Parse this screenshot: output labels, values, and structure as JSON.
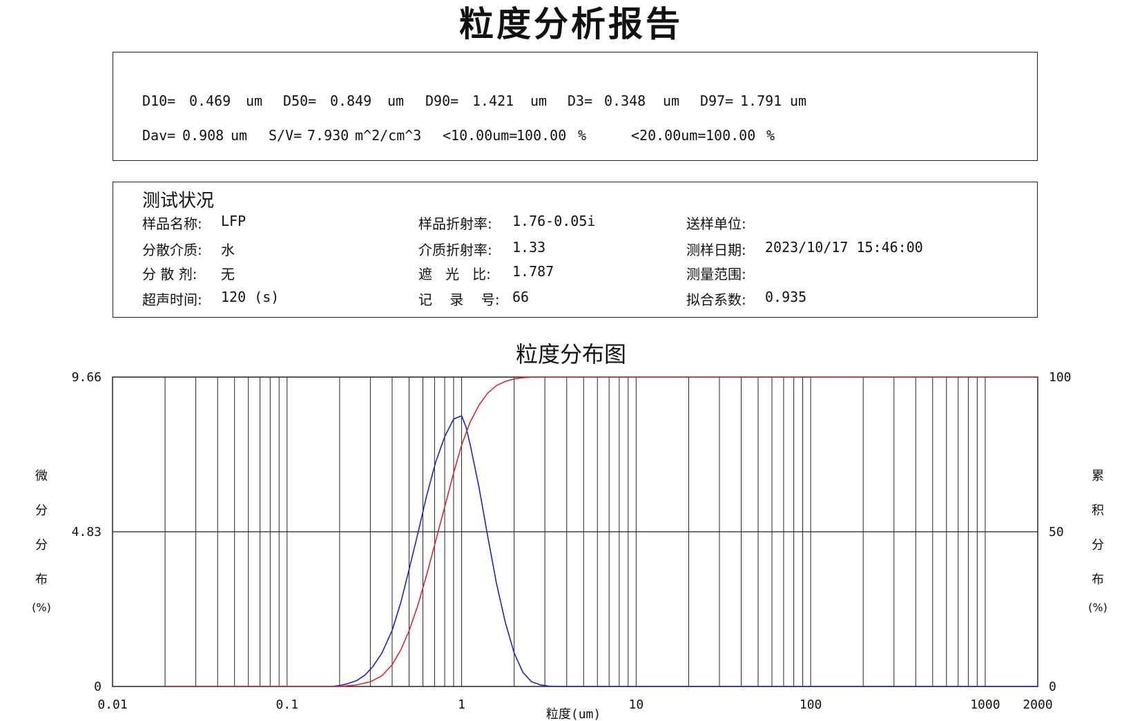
{
  "report_title": "粒度分析报告",
  "stats": {
    "row1": [
      "D10=",
      "0.469",
      "um",
      "D50=",
      "0.849",
      "um",
      "D90=",
      "1.421",
      "um",
      "D3=",
      "0.348",
      "um",
      "D97=",
      "1.791",
      "um"
    ],
    "row2": [
      "Dav=",
      "0.908",
      "um",
      "S/V=",
      "7.930",
      "m^2/cm^3",
      "<10.00um=",
      "100.00",
      "%",
      "<20.00um=",
      "100.00",
      "%"
    ]
  },
  "conditions": {
    "heading": "测试状况",
    "items": [
      {
        "label": "样品名称:",
        "value": "LFP"
      },
      {
        "label": "样品折射率:",
        "value": "1.76-0.05i"
      },
      {
        "label": "送样单位:",
        "value": ""
      },
      {
        "label": "分散介质:",
        "value": "水"
      },
      {
        "label": "介质折射率:",
        "value": "1.33"
      },
      {
        "label": "测样日期:",
        "value": "2023/10/17 15:46:00"
      },
      {
        "label": "分 散 剂:",
        "value": "无"
      },
      {
        "label": "遮   光   比:",
        "value": "1.787"
      },
      {
        "label": "测量范围:",
        "value": ""
      },
      {
        "label": "超声时间:",
        "value": "120 (s)"
      },
      {
        "label": "记    录    号:",
        "value": "66"
      },
      {
        "label": "拟合系数:",
        "value": "0.935"
      }
    ]
  },
  "chart_data": {
    "type": "line",
    "title": "粒度分布图",
    "xlabel": "粒度(um)",
    "x_scale": "log",
    "xlim": [
      0.01,
      2000
    ],
    "x_ticks": [
      "0.01",
      "0.1",
      "1",
      "10",
      "100",
      "1000",
      "2000"
    ],
    "y_left_label": "微分分布(%)",
    "y_left_ticks": [
      "0",
      "4.83",
      "9.66"
    ],
    "ylim_left": [
      0,
      9.66
    ],
    "y_right_label": "累积分布(%)",
    "y_right_ticks": [
      "0",
      "50",
      "100"
    ],
    "ylim_right": [
      0,
      100
    ],
    "grid": true,
    "series": [
      {
        "kind": "differential",
        "axis": "left",
        "color": "#1f1fc8",
        "x": [
          0.02,
          0.18,
          0.2,
          0.22,
          0.25,
          0.28,
          0.31,
          0.35,
          0.4,
          0.45,
          0.5,
          0.56,
          0.63,
          0.71,
          0.8,
          0.9,
          1.0,
          1.06,
          1.12,
          1.26,
          1.41,
          1.58,
          1.78,
          2.0,
          2.24,
          2.51,
          2.82,
          3.16,
          3.55,
          4.0,
          2000
        ],
        "y": [
          0,
          0,
          0.03,
          0.08,
          0.18,
          0.36,
          0.62,
          1.05,
          1.75,
          2.65,
          3.65,
          4.75,
          5.95,
          7.0,
          7.8,
          8.35,
          8.45,
          8.1,
          7.55,
          6.2,
          4.7,
          3.25,
          2.0,
          1.05,
          0.45,
          0.15,
          0.05,
          0.01,
          0,
          0,
          0
        ]
      },
      {
        "kind": "cumulative",
        "axis": "right",
        "color": "#d42a2a",
        "x": [
          0.02,
          0.2,
          0.25,
          0.3,
          0.35,
          0.4,
          0.45,
          0.5,
          0.56,
          0.63,
          0.71,
          0.8,
          0.9,
          1.0,
          1.12,
          1.26,
          1.41,
          1.58,
          1.78,
          2.0,
          2.24,
          2.51,
          2.82,
          3.16,
          2000
        ],
        "y": [
          0,
          0,
          0.5,
          1.5,
          3.5,
          7,
          12,
          18,
          26,
          36,
          47,
          58,
          69,
          78,
          85.5,
          91,
          94.8,
          97.2,
          98.6,
          99.4,
          99.8,
          99.95,
          100,
          100,
          100
        ]
      }
    ]
  }
}
